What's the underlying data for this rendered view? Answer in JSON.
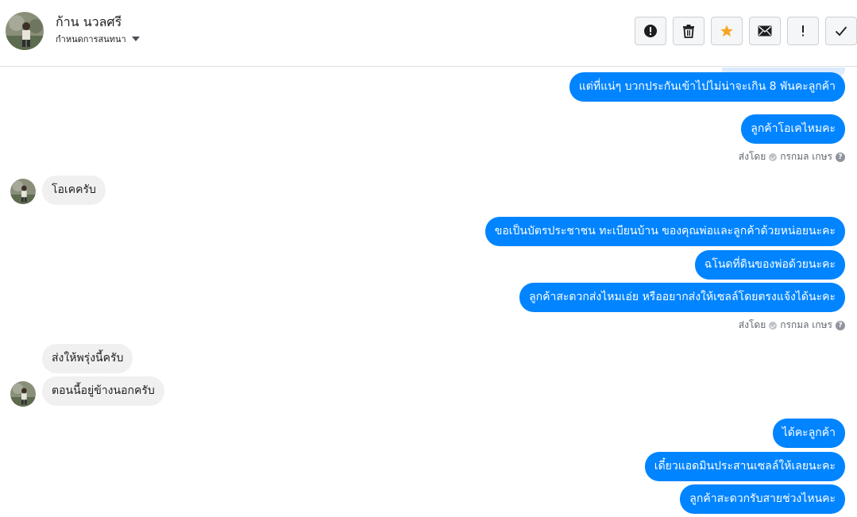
{
  "header": {
    "contact_name": "ก้าน นวลศรี",
    "assign_label": "กำหนดการสนทนา",
    "actions": {
      "report": "report-icon",
      "delete": "trash-icon",
      "star": "star-icon",
      "mark_unread": "envelope-icon",
      "important": "exclamation-icon",
      "done": "check-icon"
    }
  },
  "colors": {
    "outgoing_bubble": "#0084ff",
    "incoming_bubble": "#f1f0f0",
    "star_accent": "#f5a623"
  },
  "messages": [
    {
      "direction": "out",
      "text": "แต่ที่แน่ๆ บวกประกันเข้าไปไม่น่าจะเกิน 8 พันคะลูกค้า"
    },
    {
      "direction": "out",
      "text": "ลูกค้าโอเคไหมคะ"
    },
    {
      "direction": "in",
      "text": "โอเคครับ"
    },
    {
      "direction": "out",
      "text": "ขอเป็นบัตรประชาชน ทะเบียนบ้าน ของคุณพ่อและลูกค้าด้วยหน่อยนะคะ"
    },
    {
      "direction": "out",
      "text": "ฉโนดที่ดินของพ่อด้วยนะคะ"
    },
    {
      "direction": "out",
      "text": "ลูกค้าสะดวกส่งไหมเอ่ย หรืออยากส่งให้เซลล์โดยตรงแจ้งได้นะคะ"
    },
    {
      "direction": "in",
      "text": "ส่งให้พรุ่งนี้ครับ"
    },
    {
      "direction": "in",
      "text": "ตอนนี้อยู่ข้างนอกครับ"
    },
    {
      "direction": "out",
      "text": "ได้คะลูกค้า"
    },
    {
      "direction": "out",
      "text": "เดี๋ยวแอดมินประสานเซลล์ให้เลยนะคะ"
    },
    {
      "direction": "out",
      "text": "ลูกค้าสะดวกรับสายช่วงไหนคะ"
    }
  ],
  "sent_by": {
    "label": "ส่งโดย",
    "agent": "กรกมล เกษร"
  }
}
